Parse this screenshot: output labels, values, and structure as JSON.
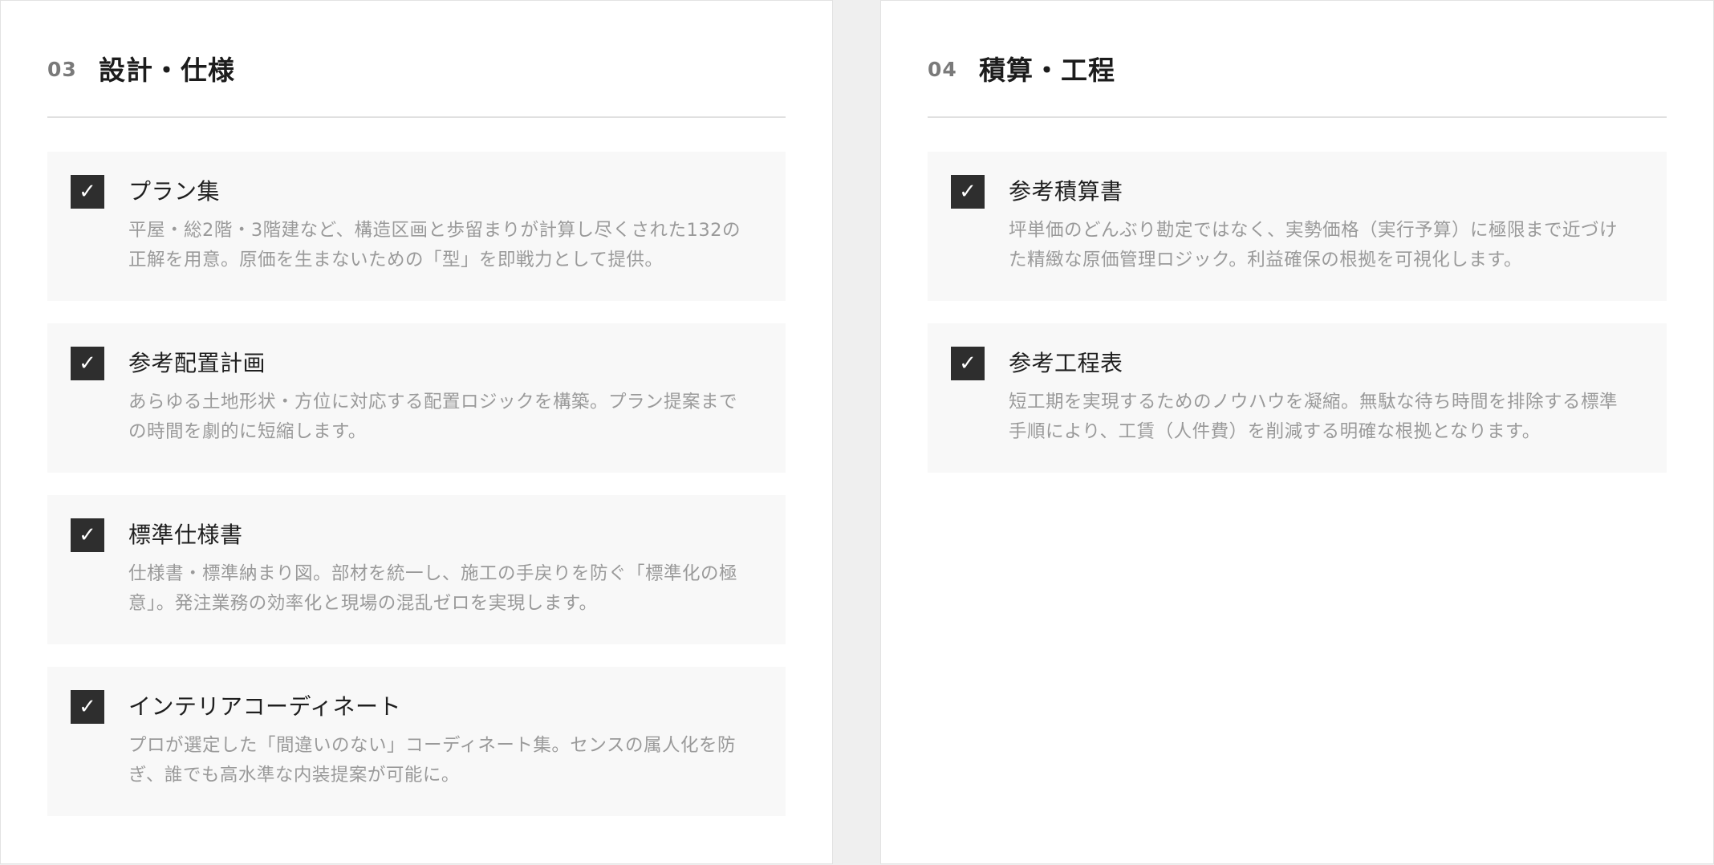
{
  "left_panel": {
    "number": "03",
    "title": "設計・仕様",
    "items": [
      {
        "check": "✓",
        "title": "プラン集",
        "description": "平屋・総2階・3階建など、構造区画と歩留まりが計算し尽くされた132の正解を用意。原価を生まないための「型」を即戦力として提供。"
      },
      {
        "check": "✓",
        "title": "参考配置計画",
        "description": "あらゆる土地形状・方位に対応する配置ロジックを構築。プラン提案までの時間を劇的に短縮します。"
      },
      {
        "check": "✓",
        "title": "標準仕様書",
        "description": "仕様書・標準納まり図。部材を統一し、施工の手戻りを防ぐ「標準化の極意」。発注業務の効率化と現場の混乱ゼロを実現します。"
      },
      {
        "check": "✓",
        "title": "インテリアコーディネート",
        "description": "プロが選定した「間違いのない」コーディネート集。センスの属人化を防ぎ、誰でも高水準な内装提案が可能に。"
      }
    ]
  },
  "right_panel": {
    "number": "04",
    "title": "積算・工程",
    "items": [
      {
        "check": "✓",
        "title": "参考積算書",
        "description": "坪単価のどんぶり勘定ではなく、実勢価格（実行予算）に極限まで近づけた精緻な原価管理ロジック。利益確保の根拠を可視化します。"
      },
      {
        "check": "✓",
        "title": "参考工程表",
        "description": "短工期を実現するためのノウハウを凝縮。無駄な待ち時間を排除する標準手順により、工賃（人件費）を削減する明確な根拠となります。"
      }
    ]
  }
}
